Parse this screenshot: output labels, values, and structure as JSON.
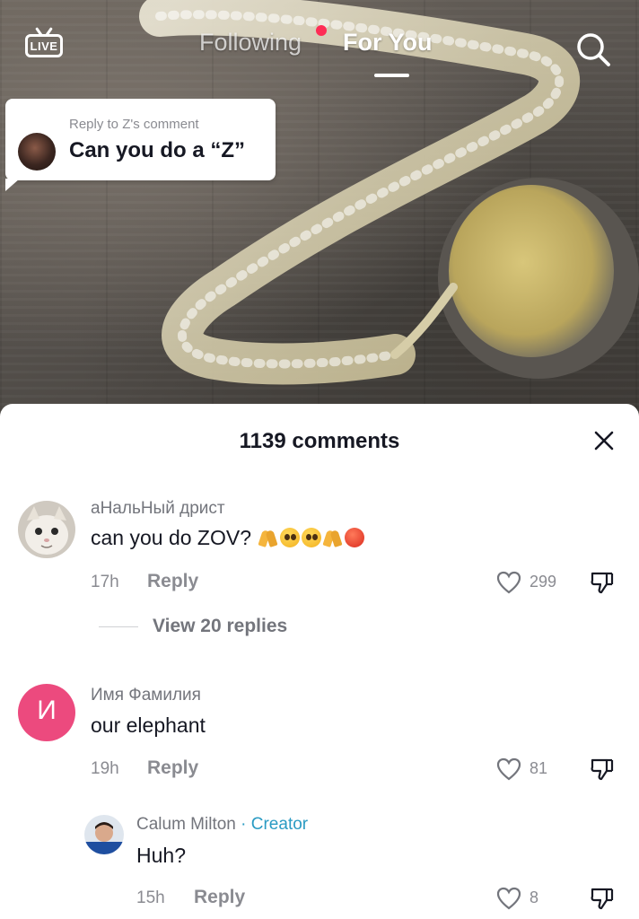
{
  "top_nav": {
    "live_label": "LIVE",
    "tabs": [
      {
        "label": "Following",
        "active": false,
        "has_notification_dot": true
      },
      {
        "label": "For You",
        "active": true
      }
    ],
    "search_icon": "search-icon"
  },
  "reply_sticker": {
    "subtitle": "Reply to Z's comment",
    "text": "Can you do a “Z”"
  },
  "comments_panel": {
    "title": "1139 comments",
    "close_icon": "close-icon",
    "comments": [
      {
        "username": "аНальНый дрист",
        "text": "can you do ZOV?",
        "emojis": [
          "folded-hands",
          "pleading-face",
          "pleading-face",
          "folded-hands",
          "hot-face"
        ],
        "time": "17h",
        "reply_label": "Reply",
        "likes": "299",
        "view_replies_label": "View 20 replies"
      },
      {
        "username": "Имя Фамилия",
        "avatar_letter": "И",
        "avatar_color": "#ec4a7e",
        "text": "our elephant",
        "time": "19h",
        "reply_label": "Reply",
        "likes": "81"
      },
      {
        "username": "Calum Milton",
        "creator_label": " · Creator",
        "text": "Huh?",
        "time": "15h",
        "reply_label": "Reply",
        "likes": "8"
      }
    ]
  },
  "colors": {
    "accent_red": "#fe2c55",
    "creator_blue": "#2a9bc3",
    "text_primary": "#161823",
    "text_secondary": "#8a8b91"
  }
}
